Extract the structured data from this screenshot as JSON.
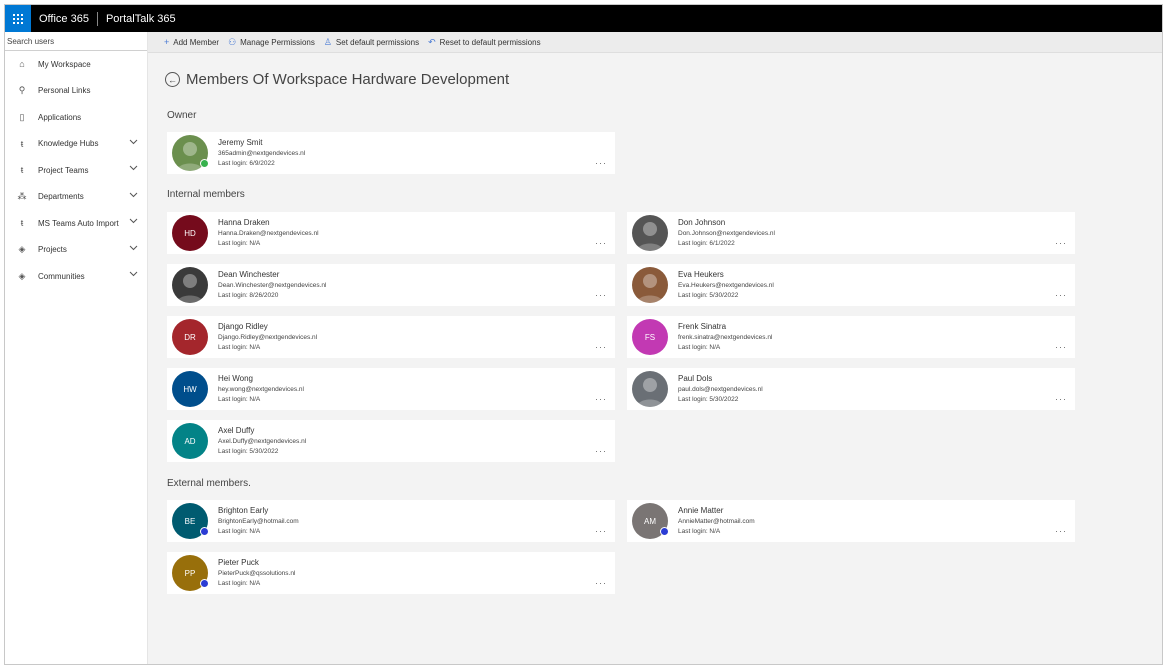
{
  "suitebar": {
    "office": "Office 365",
    "app": "PortalTalk 365"
  },
  "sidebar": {
    "search_placeholder": "Search users",
    "items": [
      {
        "label": "My Workspace",
        "icon": "home-icon",
        "glyph": "⌂",
        "expandable": false
      },
      {
        "label": "Personal Links",
        "icon": "person-icon",
        "glyph": "⚲",
        "expandable": false
      },
      {
        "label": "Applications",
        "icon": "pages-icon",
        "glyph": "▯",
        "expandable": false
      },
      {
        "label": "Knowledge Hubs",
        "icon": "teams-icon",
        "glyph": "ŧ",
        "expandable": true
      },
      {
        "label": "Project Teams",
        "icon": "teams-icon",
        "glyph": "ŧ",
        "expandable": true
      },
      {
        "label": "Departments",
        "icon": "org-icon",
        "glyph": "⁂",
        "expandable": true
      },
      {
        "label": "MS Teams Auto Import",
        "icon": "teams-icon",
        "glyph": "ŧ",
        "expandable": true
      },
      {
        "label": "Projects",
        "icon": "sharepoint-icon",
        "glyph": "◈",
        "expandable": true
      },
      {
        "label": "Communities",
        "icon": "sharepoint-icon",
        "glyph": "◈",
        "expandable": true
      }
    ]
  },
  "toolbar": {
    "add_member": "Add Member",
    "manage_permissions": "Manage Permissions",
    "set_default": "Set default permissions",
    "reset_default": "Reset to default permissions"
  },
  "page": {
    "title": "Members Of Workspace Hardware Development",
    "owner_heading": "Owner",
    "internal_heading": "Internal members",
    "external_heading": "External members."
  },
  "owner": {
    "name": "Jeremy Smit",
    "email": "365admin@nextgendevices.nl",
    "login": "Last login: 6/9/2022",
    "initials": "",
    "color": "#6b8f4e"
  },
  "internal": [
    {
      "name": "Hanna Draken",
      "email": "Hanna.Draken@nextgendevices.nl",
      "login": "Last login: N/A",
      "initials": "HD",
      "color": "#750b1c"
    },
    {
      "name": "Don Johnson",
      "email": "Don.Johnson@nextgendevices.nl",
      "login": "Last login: 6/1/2022",
      "initials": "",
      "color": "#555555"
    },
    {
      "name": "Dean Winchester",
      "email": "Dean.Winchester@nextgendevices.nl",
      "login": "Last login: 8/26/2020",
      "initials": "",
      "color": "#3a3a3a"
    },
    {
      "name": "Eva Heukers",
      "email": "Eva.Heukers@nextgendevices.nl",
      "login": "Last login: 5/30/2022",
      "initials": "",
      "color": "#8a5a3a"
    },
    {
      "name": "Django Ridley",
      "email": "Django.Ridley@nextgendevices.nl",
      "login": "Last login: N/A",
      "initials": "DR",
      "color": "#a4262c"
    },
    {
      "name": "Frenk Sinatra",
      "email": "frenk.sinatra@nextgendevices.nl",
      "login": "Last login: N/A",
      "initials": "FS",
      "color": "#c239b3"
    },
    {
      "name": "Hei Wong",
      "email": "hey.wong@nextgendevices.nl",
      "login": "Last login: N/A",
      "initials": "HW",
      "color": "#004e8c"
    },
    {
      "name": "Paul Dols",
      "email": "paul.dols@nextgendevices.nl",
      "login": "Last login: 5/30/2022",
      "initials": "",
      "color": "#6a6f75"
    },
    {
      "name": "Axel Duffy",
      "email": "Axel.Duffy@nextgendevices.nl",
      "login": "Last login: 5/30/2022",
      "initials": "AD",
      "color": "#038387"
    }
  ],
  "external": [
    {
      "name": "Brighton Early",
      "email": "BrightonEarly@hotmail.com",
      "login": "Last login: N/A",
      "initials": "BE",
      "color": "#005b70"
    },
    {
      "name": "Annie Matter",
      "email": "AnnieMatter@hotmail.com",
      "login": "Last login: N/A",
      "initials": "AM",
      "color": "#7a7574"
    },
    {
      "name": "Pieter Puck",
      "email": "PieterPuck@qssolutions.nl",
      "login": "Last login: N/A",
      "initials": "PP",
      "color": "#986f0b"
    }
  ],
  "more_glyph": "···"
}
